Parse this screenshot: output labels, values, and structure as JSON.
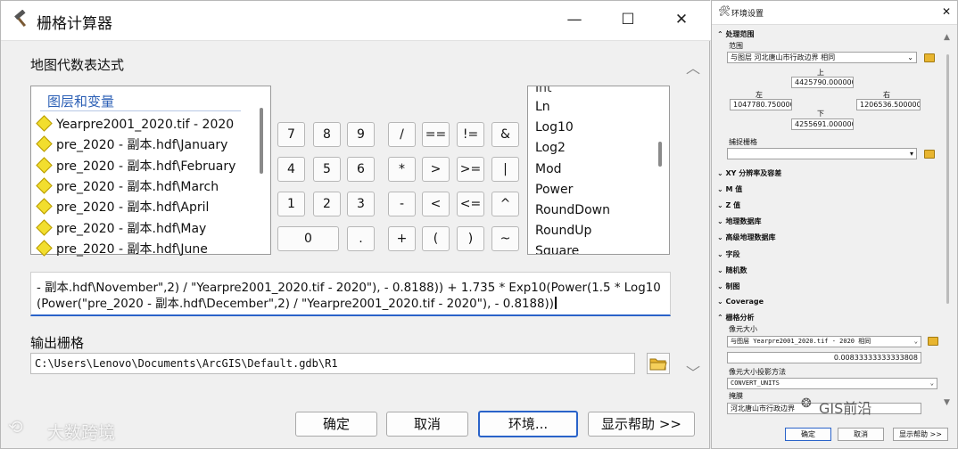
{
  "main": {
    "title": "栅格计算器",
    "expr_label": "地图代数表达式",
    "layers_header": "图层和变量",
    "layers": [
      "Yearpre2001_2020.tif - 2020",
      "pre_2020 - 副本.hdf\\January",
      "pre_2020 - 副本.hdf\\February",
      "pre_2020 - 副本.hdf\\March",
      "pre_2020 - 副本.hdf\\April",
      "pre_2020 - 副本.hdf\\May",
      "pre_2020 - 副本.hdf\\June"
    ],
    "keys": {
      "r1": [
        "7",
        "8",
        "9",
        "/",
        "==",
        "!=",
        "&"
      ],
      "r2": [
        "4",
        "5",
        "6",
        "*",
        ">",
        ">=",
        "|"
      ],
      "r3": [
        "1",
        "2",
        "3",
        "-",
        "<",
        "<=",
        "^"
      ],
      "r4": [
        "0",
        ".",
        "+",
        "(",
        ")",
        "~"
      ]
    },
    "functions_partial_top": "Int",
    "functions": [
      "Ln",
      "Log10",
      "Log2",
      "Mod",
      "Power",
      "RoundDown",
      "RoundUp",
      "Square"
    ],
    "expression_line1": "- 副本.hdf\\November\",2) / \"Yearpre2001_2020.tif - 2020\"), - 0.8188)) + 1.735 * Exp10(Power(1.5 * Log10",
    "expression_line2": "(Power(\"pre_2020 - 副本.hdf\\December\",2) / \"Yearpre2001_2020.tif - 2020\"), - 0.8188))",
    "output_label": "输出栅格",
    "output_value": "C:\\Users\\Lenovo\\Documents\\ArcGIS\\Default.gdb\\R1",
    "buttons": {
      "ok": "确定",
      "cancel": "取消",
      "env": "环境...",
      "help": "显示帮助 >>"
    },
    "watermark": "大数跨境"
  },
  "env": {
    "title": "环境设置",
    "processing_extent": "处理范围",
    "extent_label": "范围",
    "extent_value": "与图层 河北唐山市行政边界 相同",
    "top_label": "上",
    "top_value": "4425790.000000",
    "left_label": "左",
    "left_value": "1047780.750000",
    "right_label": "右",
    "right_value": "1206536.500000",
    "bottom_label": "下",
    "bottom_value": "4255691.000000",
    "snap_label": "捕捉栅格",
    "collapsed": [
      "XY 分辨率及容差",
      "M 值",
      "Z 值",
      "地理数据库",
      "高级地理数据库",
      "字段",
      "随机数",
      "制图",
      "Coverage"
    ],
    "raster_analysis": "栅格分析",
    "cell_size_label": "像元大小",
    "cell_size_value": "与图层 Yearpre2001_2020.tif - 2020 相同",
    "cell_size_number": "0.00833333333333808",
    "cell_method_label": "像元大小投影方法",
    "cell_method_value": "CONVERT_UNITS",
    "mask_label": "掩膜",
    "mask_value": "河北唐山市行政边界",
    "buttons": {
      "ok": "确定",
      "cancel": "取消",
      "help": "显示帮助 >>"
    },
    "watermark": "GIS前沿"
  }
}
